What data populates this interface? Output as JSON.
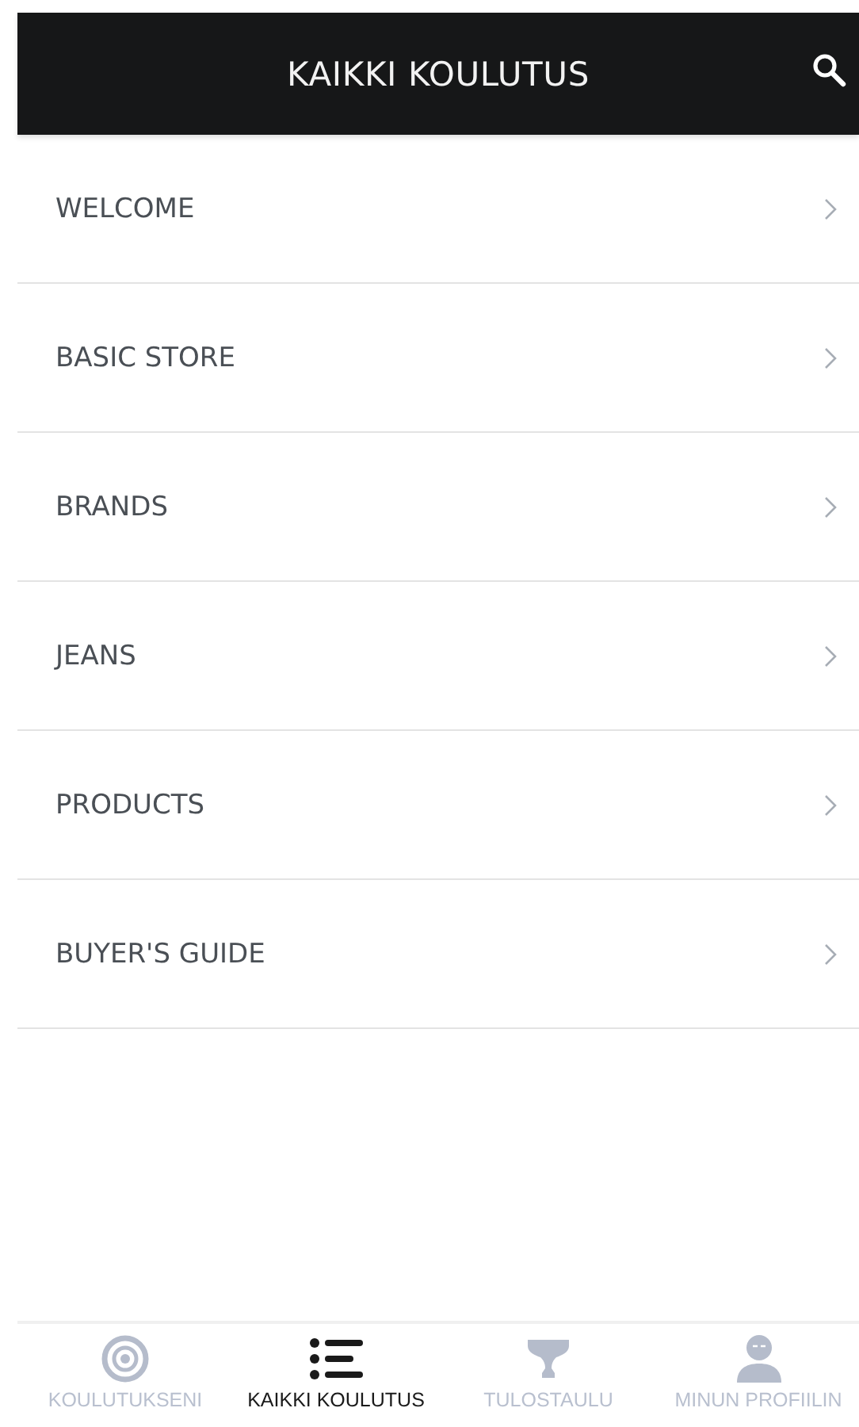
{
  "header": {
    "title": "KAIKKI KOULUTUS"
  },
  "courses": [
    {
      "label": "WELCOME"
    },
    {
      "label": "BASIC STORE"
    },
    {
      "label": "BRANDS"
    },
    {
      "label": "JEANS"
    },
    {
      "label": "PRODUCTS"
    },
    {
      "label": "BUYER'S GUIDE"
    }
  ],
  "tab_bar": [
    {
      "kind": "target",
      "label": "KOULUTUKSENI",
      "selected": false
    },
    {
      "kind": "list",
      "label": "KAIKKI KOULUTUS",
      "selected": true
    },
    {
      "kind": "trophy",
      "label": "TULOSTAULU",
      "selected": false
    },
    {
      "kind": "person",
      "label": "MINUN PROFIILIN",
      "selected": false
    }
  ]
}
